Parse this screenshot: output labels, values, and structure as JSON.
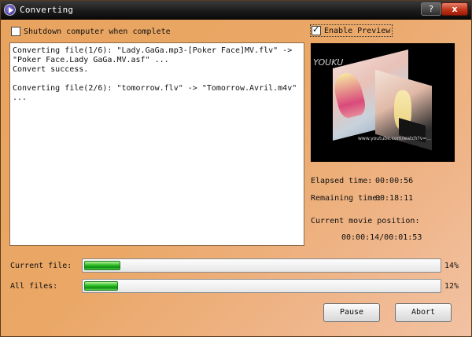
{
  "window": {
    "title": "Converting",
    "help_label": "?",
    "close_label": "x"
  },
  "options": {
    "shutdown_label": "Shutdown computer when complete",
    "shutdown_checked": false,
    "preview_label": "Enable Preview",
    "preview_checked": true
  },
  "log": {
    "text": "Converting file(1/6): \"Lady.GaGa.mp3-[Poker Face]MV.flv\" -> \"Poker Face.Lady GaGa.MV.asf\" ...\nConvert success.\n\nConverting file(2/6): \"tomorrow.flv\" -> \"Tomorrow.Avril.m4v\" ..."
  },
  "preview": {
    "watermark": "YOUKU",
    "caption": "www.youtube.com/watch?v=..."
  },
  "stats": {
    "elapsed_label": "Elapsed time:",
    "elapsed_value": "00:00:56",
    "remaining_label": "Remaining time:",
    "remaining_value": "00:18:11",
    "position_label": "Current movie position:",
    "position_value": "00:00:14/00:01:53"
  },
  "progress": {
    "current_label": "Current file:",
    "current_percent": "14%",
    "current_fraction": 0.14,
    "all_label": "All files:",
    "all_percent": "12%",
    "all_fraction": 0.12,
    "fill_color": "#2ebc25"
  },
  "buttons": {
    "pause_label": "Pause",
    "abort_label": "Abort"
  }
}
